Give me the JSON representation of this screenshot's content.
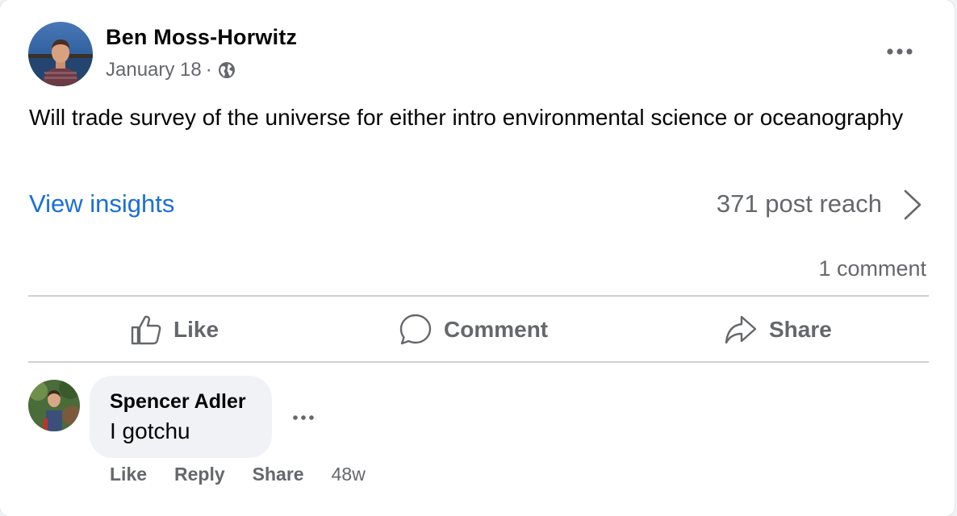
{
  "post": {
    "author": "Ben Moss-Horwitz",
    "date": "January 18",
    "separator": "·",
    "audience_icon": "globe-icon",
    "text": "Will trade survey of the universe for either intro environmental science or oceanography",
    "insights_label": "View insights",
    "reach_label": "371 post reach",
    "comment_count": "1 comment"
  },
  "actions": {
    "like": "Like",
    "comment": "Comment",
    "share": "Share"
  },
  "comment": {
    "author": "Spencer Adler",
    "text": "I gotchu",
    "like": "Like",
    "reply": "Reply",
    "share": "Share",
    "time": "48w"
  },
  "colors": {
    "link": "#1a6ed8",
    "secondary_text": "#65676b",
    "primary_text": "#050505",
    "bubble": "#f0f2f5"
  }
}
